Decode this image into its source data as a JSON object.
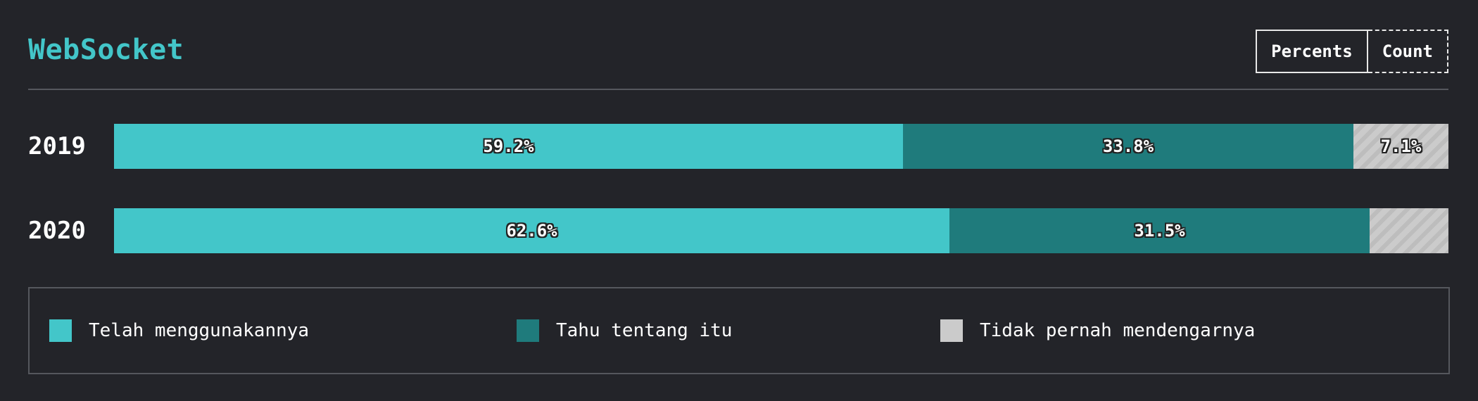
{
  "header": {
    "title": "WebSocket",
    "toggle": {
      "percents_label": "Percents",
      "count_label": "Count",
      "active": "Percents"
    }
  },
  "colors": {
    "used": "#43c6c9",
    "heard": "#1f7b7c",
    "never": "#cbcbcb",
    "title": "#43c6c9"
  },
  "chart_data": {
    "type": "bar",
    "orientation": "horizontal",
    "stacked": true,
    "normalized": true,
    "title": "WebSocket",
    "categories": [
      "2019",
      "2020"
    ],
    "series": [
      {
        "name": "Telah menggunakannya",
        "color": "#43c6c9",
        "values": [
          59.2,
          62.6
        ],
        "labels": [
          "59.2%",
          "62.6%"
        ]
      },
      {
        "name": "Tahu tentang itu",
        "color": "#1f7b7c",
        "values": [
          33.8,
          31.5
        ],
        "labels": [
          "33.8%",
          "31.5%"
        ]
      },
      {
        "name": "Tidak pernah mendengarnya",
        "color": "#cbcbcb",
        "values": [
          7.1,
          5.9
        ],
        "labels": [
          "7.1%",
          ""
        ]
      }
    ],
    "xlim": [
      0,
      100
    ],
    "grid": false,
    "legend_position": "bottom"
  },
  "legend": [
    {
      "label": "Telah menggunakannya",
      "color": "#43c6c9"
    },
    {
      "label": "Tahu tentang itu",
      "color": "#1f7b7c"
    },
    {
      "label": "Tidak pernah mendengarnya",
      "color": "#cbcbcb"
    }
  ]
}
